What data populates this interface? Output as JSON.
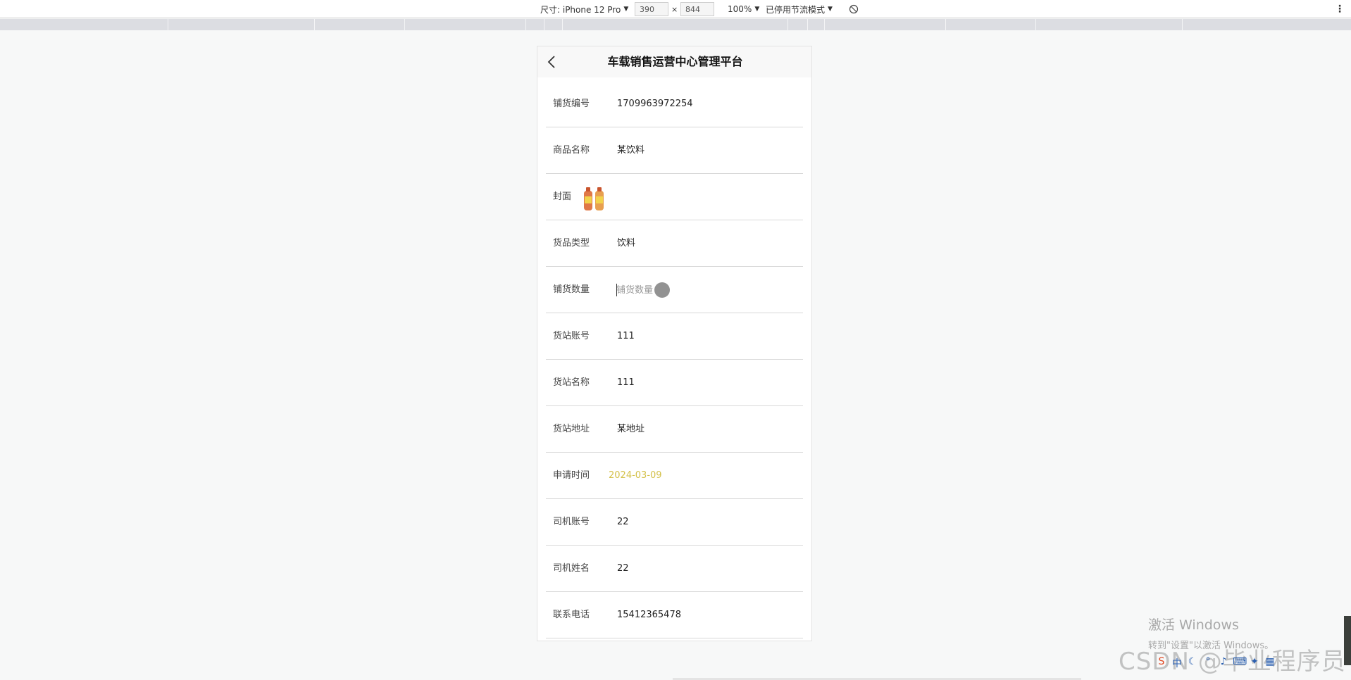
{
  "devtools": {
    "device_label": "尺寸: iPhone 12 Pro",
    "width": "390",
    "times": "×",
    "height": "844",
    "zoom": "100%",
    "throttle": "已停用节流模式"
  },
  "app": {
    "title": "车载销售运营中心管理平台"
  },
  "form": {
    "rows": [
      {
        "label": "铺货编号",
        "value": "1709963972254"
      },
      {
        "label": "商品名称",
        "value": "某饮料"
      },
      {
        "label": "封面"
      },
      {
        "label": "货品类型",
        "value": "饮料"
      },
      {
        "label": "铺货数量",
        "placeholder": "铺货数量"
      },
      {
        "label": "货站账号",
        "value": "111"
      },
      {
        "label": "货站名称",
        "value": "111"
      },
      {
        "label": "货站地址",
        "value": "某地址"
      },
      {
        "label": "申请时间",
        "value": "2024-03-09"
      },
      {
        "label": "司机账号",
        "value": "22"
      },
      {
        "label": "司机姓名",
        "value": "22"
      },
      {
        "label": "联系电话",
        "value": "15412365478"
      }
    ]
  },
  "watermark": {
    "activate_title": "激活 Windows",
    "activate_sub": "转到\"设置\"以激活 Windows。",
    "csdn": "CSDN @毕业程序员"
  },
  "colors": {
    "date_value": "#d4c14a",
    "nav_bg": "#f8f8f8",
    "page_bg": "#f7f8f8"
  }
}
